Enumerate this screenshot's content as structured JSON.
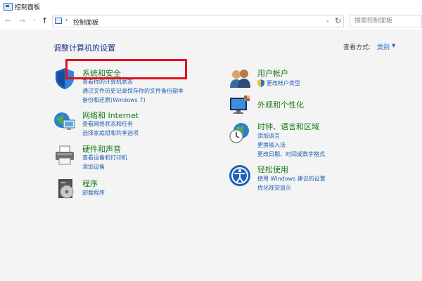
{
  "window": {
    "title": "控制面板"
  },
  "nav": {
    "back_glyph": "←",
    "forward_glyph": "→",
    "history_glyph": "⌄",
    "up_glyph": "↑",
    "breadcrumb_sep": "›",
    "breadcrumb": "控制面板",
    "dropdown_glyph": "⌄",
    "refresh_glyph": "↻",
    "search_placeholder": "搜索控制面板"
  },
  "header": {
    "title": "调整计算机的设置",
    "view_by_label": "查看方式:",
    "view_by_value": "类别",
    "view_caret": "▼"
  },
  "categories": {
    "system_security": {
      "icon": "shield-icon",
      "title": "系统和安全",
      "links": [
        "查看你的计算机状态",
        "通过文件历史记录保存你的文件备份副本",
        "备份和还原(Windows 7)"
      ]
    },
    "network": {
      "icon": "network-globe-icon",
      "title": "网络和 Internet",
      "links": [
        "查看网络状态和任务",
        "选择家庭组和共享选项"
      ]
    },
    "hardware": {
      "icon": "printer-icon",
      "title": "硬件和声音",
      "links": [
        "查看设备和打印机",
        "添加设备"
      ]
    },
    "programs": {
      "icon": "programs-disk-icon",
      "title": "程序",
      "links": [
        "卸载程序"
      ]
    },
    "user_accounts": {
      "icon": "users-icon",
      "title": "用户帐户",
      "links": [
        "更改帐户类型"
      ]
    },
    "appearance": {
      "icon": "monitor-palette-icon",
      "title": "外观和个性化",
      "links": []
    },
    "clock_region": {
      "icon": "clock-globe-icon",
      "title": "时钟、语言和区域",
      "links": [
        "添加语言",
        "更换输入法",
        "更改日期、时间或数字格式"
      ]
    },
    "ease_access": {
      "icon": "accessibility-icon",
      "title": "轻松使用",
      "links": [
        "使用 Windows 建议的设置",
        "优化视觉显示"
      ]
    }
  },
  "colors": {
    "category_title": "#1a7a1a",
    "link": "#1f5fb0",
    "page_title": "#1e3287",
    "highlight": "#e0121b"
  }
}
